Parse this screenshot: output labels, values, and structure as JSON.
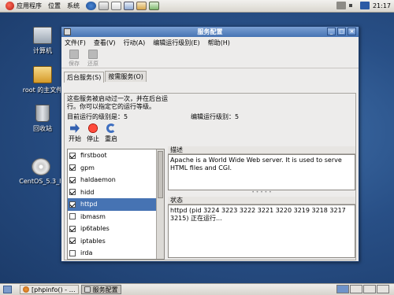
{
  "top_panel": {
    "menus": [
      "应用程序",
      "位置",
      "系统"
    ],
    "clock": "21:17"
  },
  "desktop_icons": [
    {
      "label": "计算机",
      "icon": "computer-icon"
    },
    {
      "label": "root 的主文件",
      "icon": "home-folder-icon"
    },
    {
      "label": "回收站",
      "icon": "trash-icon"
    },
    {
      "label": "CentOS_5.3_F",
      "icon": "dvd-icon"
    }
  ],
  "window": {
    "title": "服务配置",
    "menu": [
      "文件(F)",
      "查看(V)",
      "行动(A)",
      "编辑运行级别(E)",
      "帮助(H)"
    ],
    "toolbar": {
      "save": "保存",
      "revert": "还原"
    },
    "tabs": [
      "后台服务(S)",
      "按需服务(O)"
    ],
    "description": "这些服务被启动过一次，并在后台运行。你可以指定它的运行等级。",
    "current_runlevel": "目前运行的级别是：5",
    "edit_runlevel": "编辑运行级别：5",
    "service_actions": {
      "start": "开始",
      "stop": "停止",
      "restart": "重启"
    },
    "services": [
      {
        "name": "firstboot",
        "checked": true,
        "selected": false
      },
      {
        "name": "gpm",
        "checked": true,
        "selected": false
      },
      {
        "name": "haldaemon",
        "checked": true,
        "selected": false
      },
      {
        "name": "hidd",
        "checked": true,
        "selected": false
      },
      {
        "name": "httpd",
        "checked": true,
        "selected": true
      },
      {
        "name": "ibmasm",
        "checked": false,
        "selected": false
      },
      {
        "name": "ip6tables",
        "checked": true,
        "selected": false
      },
      {
        "name": "iptables",
        "checked": true,
        "selected": false
      },
      {
        "name": "irda",
        "checked": false,
        "selected": false
      }
    ],
    "description_label": "描述",
    "description_text": "Apache is a World Wide Web server.  It is used to serve HTML files and CGI.",
    "status_label": "状态",
    "status_text": "httpd (pid 3224 3223 3222 3221 3220 3219 3218 3217 3215) 正在运行..."
  },
  "taskbar": {
    "tasks": [
      {
        "label": "[phpinfo() - …",
        "active": false
      },
      {
        "label": "服务配置",
        "active": true
      }
    ]
  },
  "colors": {
    "desktop": "#284f86",
    "selection": "#4673b3",
    "titlebar": "#4673b3"
  }
}
